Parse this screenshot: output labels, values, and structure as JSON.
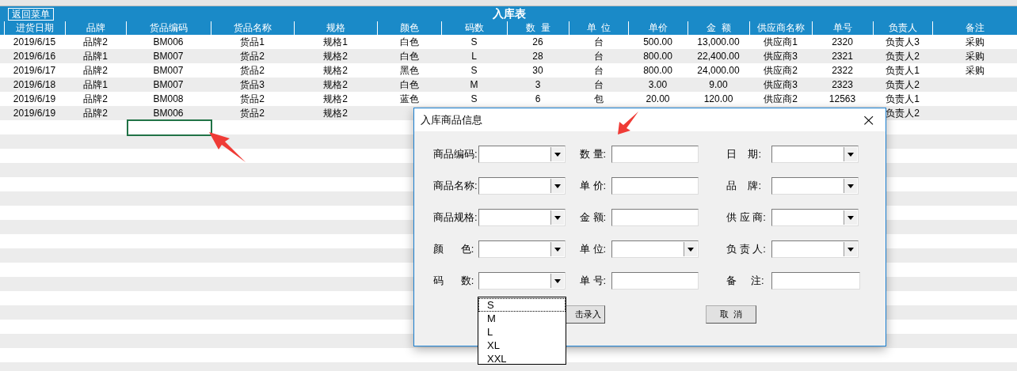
{
  "toolbar": {
    "back_button": "返回菜单",
    "title": "入库表"
  },
  "table": {
    "columns": [
      "进货日期",
      "品牌",
      "货品编码",
      "货品名称",
      "规格",
      "颜色",
      "码数",
      "数  量",
      "单  位",
      "单价",
      "金  额",
      "供应商名称",
      "单号",
      "负责人",
      "备注"
    ],
    "rows": [
      [
        "2019/6/15",
        "品牌2",
        "BM006",
        "货品1",
        "规格1",
        "白色",
        "S",
        "26",
        "台",
        "500.00",
        "13,000.00",
        "供应商1",
        "2320",
        "负责人3",
        "采购"
      ],
      [
        "2019/6/16",
        "品牌1",
        "BM007",
        "货品2",
        "规格2",
        "白色",
        "L",
        "28",
        "台",
        "800.00",
        "22,400.00",
        "供应商3",
        "2321",
        "负责人2",
        "采购"
      ],
      [
        "2019/6/17",
        "品牌2",
        "BM007",
        "货品2",
        "规格2",
        "黑色",
        "S",
        "30",
        "台",
        "800.00",
        "24,000.00",
        "供应商2",
        "2322",
        "负责人1",
        "采购"
      ],
      [
        "2019/6/18",
        "品牌1",
        "BM007",
        "货品3",
        "规格2",
        "白色",
        "M",
        "3",
        "台",
        "3.00",
        "9.00",
        "供应商3",
        "2323",
        "负责人2",
        null
      ],
      [
        "2019/6/19",
        "品牌2",
        "BM008",
        "货品2",
        "规格2",
        "蓝色",
        "S",
        "6",
        "包",
        "20.00",
        "120.00",
        "供应商2",
        "12563",
        "负责人1",
        null
      ],
      [
        "2019/6/19",
        "品牌2",
        "BM006",
        "货品2",
        "规格2",
        null,
        null,
        null,
        null,
        null,
        null,
        null,
        null,
        "负责人2",
        null
      ]
    ]
  },
  "dialog": {
    "title": "入库商品信息",
    "close": "×",
    "fields": [
      {
        "label": "商品编码:",
        "kind": "combo"
      },
      {
        "label": "数 量:",
        "kind": "text"
      },
      {
        "label": "日    期:",
        "kind": "combo"
      },
      {
        "label": "商品名称:",
        "kind": "combo"
      },
      {
        "label": "单 价:",
        "kind": "text"
      },
      {
        "label": "品    牌:",
        "kind": "combo"
      },
      {
        "label": "商品规格:",
        "kind": "combo"
      },
      {
        "label": "金 额:",
        "kind": "text"
      },
      {
        "label": "供 应 商:",
        "kind": "combo"
      },
      {
        "label": "颜      色:",
        "kind": "combo"
      },
      {
        "label": "单 位:",
        "kind": "combo"
      },
      {
        "label": "负 责 人:",
        "kind": "combo"
      },
      {
        "label": "码      数:",
        "kind": "combo"
      },
      {
        "label": "单 号:",
        "kind": "text"
      },
      {
        "label": "备     注:",
        "kind": "text"
      }
    ],
    "submit_button": "击录入",
    "cancel_button": "取  消",
    "dropdown": [
      {
        "label": "S",
        "selected": true
      },
      {
        "label": "M",
        "selected": false
      },
      {
        "label": "L",
        "selected": false
      },
      {
        "label": "XL",
        "selected": false
      },
      {
        "label": "XXL",
        "selected": false
      }
    ]
  }
}
